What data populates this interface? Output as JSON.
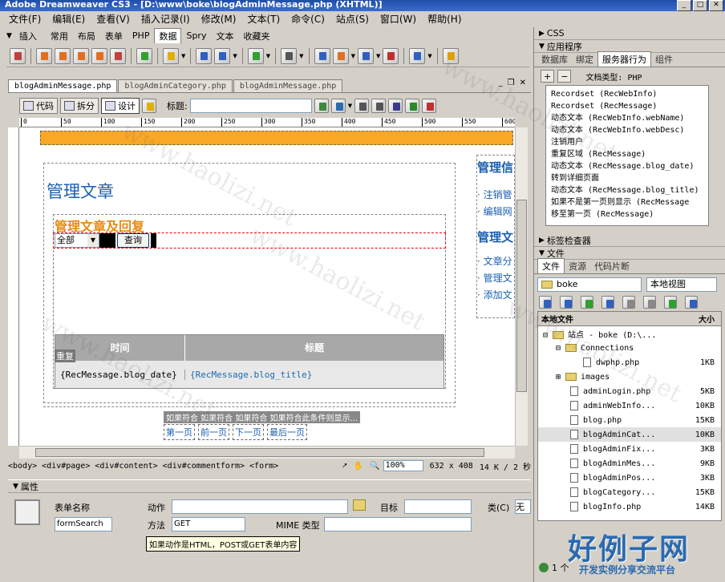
{
  "window": {
    "title": "Adobe Dreamweaver CS3 - [D:\\www\\boke\\blogAdminMessage.php (XHTML)]"
  },
  "menu": [
    "文件(F)",
    "编辑(E)",
    "查看(V)",
    "插入记录(I)",
    "修改(M)",
    "文本(T)",
    "命令(C)",
    "站点(S)",
    "窗口(W)",
    "帮助(H)"
  ],
  "insert_bar": {
    "label": "插入",
    "tabs": [
      "常用",
      "布局",
      "表单",
      "PHP",
      "数据",
      "Spry",
      "文本",
      "收藏夹"
    ],
    "active_tab": "数据"
  },
  "doc_tabs": [
    "blogAdminMessage.php",
    "blogAdminCategory.php",
    "blogAdminMessage.php"
  ],
  "view_bar": {
    "code": "代码",
    "split": "拆分",
    "design": "设计",
    "title_label": "标题:",
    "title_value": ""
  },
  "ruler": [
    "0",
    "50",
    "100",
    "150",
    "200",
    "250",
    "300",
    "350",
    "400",
    "450",
    "500",
    "550",
    "600"
  ],
  "page": {
    "heading": "管理文章",
    "subheading": "管理文章及回复",
    "select_value": "全部",
    "query_button": "查询",
    "repeat_tag": "重复",
    "table_headers": [
      "时间",
      "标题"
    ],
    "cells": [
      "{RecMessage.blog_date}",
      "{RecMessage.blog_title}"
    ],
    "condition_text": "如果符合 如果符合 如果符合 如果符合此条件则显示...",
    "pager": [
      "第一页",
      "前一页",
      "下一页",
      "最后一页"
    ],
    "side_title1": "管理信",
    "side_links1": [
      "注销管",
      "编辑网"
    ],
    "side_title2": "管理文",
    "side_links2": [
      "文章分",
      "管理文",
      "添加文"
    ]
  },
  "status": {
    "tags": "<body> <div#page> <div#content> <div#commentform> <form>",
    "zoom": "100%",
    "size": "632 x 408",
    "weight": "14 K / 2 秒"
  },
  "properties": {
    "title": "属性",
    "form_name_label": "表单名称",
    "form_name_value": "formSearch",
    "action_label": "动作",
    "action_value": "",
    "target_label": "目标",
    "method_label": "方法",
    "method_value": "GET",
    "mime_label": "MIME 类型",
    "class_label": "类(C)",
    "class_value": "无",
    "tooltip": "如果动作是HTML，POST或GET表单内容"
  },
  "right": {
    "css": "CSS",
    "app": "应用程序",
    "app_tabs": [
      "数据库",
      "绑定",
      "服务器行为",
      "组件"
    ],
    "app_active": "服务器行为",
    "doc_type": "文档类型: PHP",
    "behaviors": [
      "Recordset (RecWebInfo)",
      "Recordset (RecMessage)",
      "动态文本 (RecWebInfo.webName)",
      "动态文本 (RecWebInfo.webDesc)",
      "注销用户",
      "重复区域 (RecMessage)",
      "动态文本 (RecMessage.blog_date)",
      "转到详细页面",
      "动态文本 (RecMessage.blog_title)",
      "如果不是第一页则显示 (RecMessage",
      "移至第一页 (RecMessage)"
    ],
    "tag_inspector": "标签检查器",
    "files": "文件",
    "files_tabs": [
      "文件",
      "资源",
      "代码片断"
    ],
    "site": "boke",
    "view": "本地视图",
    "col_name": "本地文件",
    "col_size": "大小",
    "file_list": [
      {
        "name": "站点 - boke (D:\\...",
        "size": "",
        "type": "site"
      },
      {
        "name": "Connections",
        "size": "",
        "type": "folder"
      },
      {
        "name": "dwphp.php",
        "size": "1KB",
        "type": "file"
      },
      {
        "name": "images",
        "size": "",
        "type": "folder"
      },
      {
        "name": "adminLogin.php",
        "size": "5KB",
        "type": "file"
      },
      {
        "name": "adminWebInfo...",
        "size": "10KB",
        "type": "file"
      },
      {
        "name": "blog.php",
        "size": "15KB",
        "type": "file"
      },
      {
        "name": "blogAdminCat...",
        "size": "10KB",
        "type": "file"
      },
      {
        "name": "blogAdminFix...",
        "size": "3KB",
        "type": "file"
      },
      {
        "name": "blogAdminMes...",
        "size": "9KB",
        "type": "file"
      },
      {
        "name": "blogAdminPos...",
        "size": "3KB",
        "type": "file"
      },
      {
        "name": "blogCategory...",
        "size": "15KB",
        "type": "file"
      },
      {
        "name": "blogInfo.php",
        "size": "14KB",
        "type": "file"
      }
    ],
    "footer": "1 个"
  },
  "watermark": "www.haolizi.net",
  "logo": "好例子网",
  "logo_sub": "开发实例分享交流平台"
}
